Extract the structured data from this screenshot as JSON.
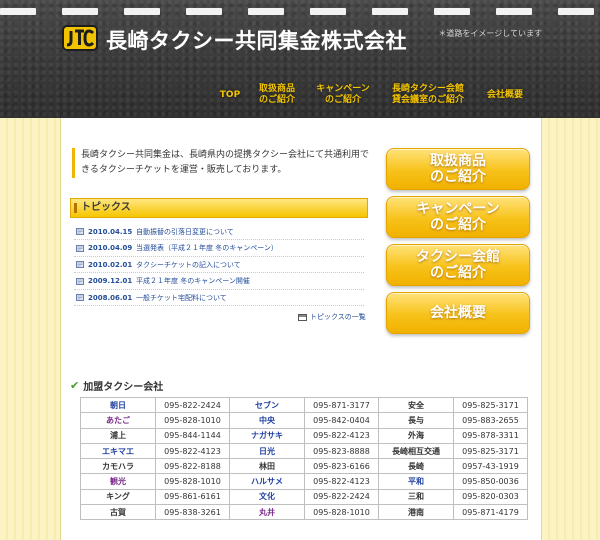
{
  "header": {
    "title": "長崎タクシー共同集金株式会社",
    "logo_text": "JTC",
    "note": "＊道路をイメージしています"
  },
  "nav": [
    {
      "label": "TOP"
    },
    {
      "label": "取扱商品\nのご紹介"
    },
    {
      "label": "キャンペーン\nのご紹介"
    },
    {
      "label": "長崎タクシー会館\n貸会議室のご紹介"
    },
    {
      "label": "会社概要"
    }
  ],
  "intro": "長崎タクシー共同集金は、長崎県内の提携タクシー会社にて共通利用できるタクシーチケットを運営・販売しております。",
  "topics": {
    "heading": "トピックス",
    "items": [
      {
        "date": "2010.04.15",
        "title": "自動振替の引落日変更について"
      },
      {
        "date": "2010.04.09",
        "title": "当選発表（平成２１年度 冬のキャンペーン）"
      },
      {
        "date": "2010.02.01",
        "title": "タクシーチケットの記入について"
      },
      {
        "date": "2009.12.01",
        "title": "平成２１年度 冬のキャンペーン開催"
      },
      {
        "date": "2008.06.01",
        "title": "一般チケット宅配料について"
      }
    ],
    "more": "トピックスの一覧"
  },
  "side_buttons": [
    {
      "label": "取扱商品\nのご紹介"
    },
    {
      "label": "キャンペーン\nのご紹介"
    },
    {
      "label": "タクシー会館\nのご紹介"
    },
    {
      "label": "会社概要"
    }
  ],
  "members": {
    "heading": "加盟タクシー会社",
    "rows": [
      [
        {
          "name": "朝日",
          "color": "blue",
          "phone": "095-822-2424"
        },
        {
          "name": "セブン",
          "color": "blue",
          "phone": "095-871-3177"
        },
        {
          "name": "安全",
          "color": "black",
          "phone": "095-825-3171"
        }
      ],
      [
        {
          "name": "あたご",
          "color": "purple",
          "phone": "095-828-1010"
        },
        {
          "name": "中央",
          "color": "blue",
          "phone": "095-842-0404"
        },
        {
          "name": "長与",
          "color": "black",
          "phone": "095-883-2655"
        }
      ],
      [
        {
          "name": "浦上",
          "color": "black",
          "phone": "095-844-1144"
        },
        {
          "name": "ナガサキ",
          "color": "blue",
          "phone": "095-822-4123"
        },
        {
          "name": "外海",
          "color": "black",
          "phone": "095-878-3311"
        }
      ],
      [
        {
          "name": "エキマエ",
          "color": "blue",
          "phone": "095-822-4123"
        },
        {
          "name": "日光",
          "color": "blue",
          "phone": "095-823-8888"
        },
        {
          "name": "長崎相互交通",
          "color": "black",
          "phone": "095-825-3171"
        }
      ],
      [
        {
          "name": "カモハラ",
          "color": "black",
          "phone": "095-822-8188"
        },
        {
          "name": "林田",
          "color": "black",
          "phone": "095-823-6166"
        },
        {
          "name": "長崎",
          "color": "black",
          "phone": "0957-43-1919"
        }
      ],
      [
        {
          "name": "観光",
          "color": "purple",
          "phone": "095-828-1010"
        },
        {
          "name": "ハルサメ",
          "color": "blue",
          "phone": "095-822-4123"
        },
        {
          "name": "平和",
          "color": "blue",
          "phone": "095-850-0036"
        }
      ],
      [
        {
          "name": "キング",
          "color": "black",
          "phone": "095-861-6161"
        },
        {
          "name": "文化",
          "color": "blue",
          "phone": "095-822-2424"
        },
        {
          "name": "三和",
          "color": "black",
          "phone": "095-820-0303"
        }
      ],
      [
        {
          "name": "古賀",
          "color": "black",
          "phone": "095-838-3261"
        },
        {
          "name": "丸井",
          "color": "purple",
          "phone": "095-828-1010"
        },
        {
          "name": "港南",
          "color": "black",
          "phone": "095-871-4179"
        }
      ]
    ]
  },
  "colors": {
    "accent": "#f2c400",
    "link": "#234c99",
    "header_bg": "#3c3c3c",
    "page_bg": "#fbf3c4"
  }
}
